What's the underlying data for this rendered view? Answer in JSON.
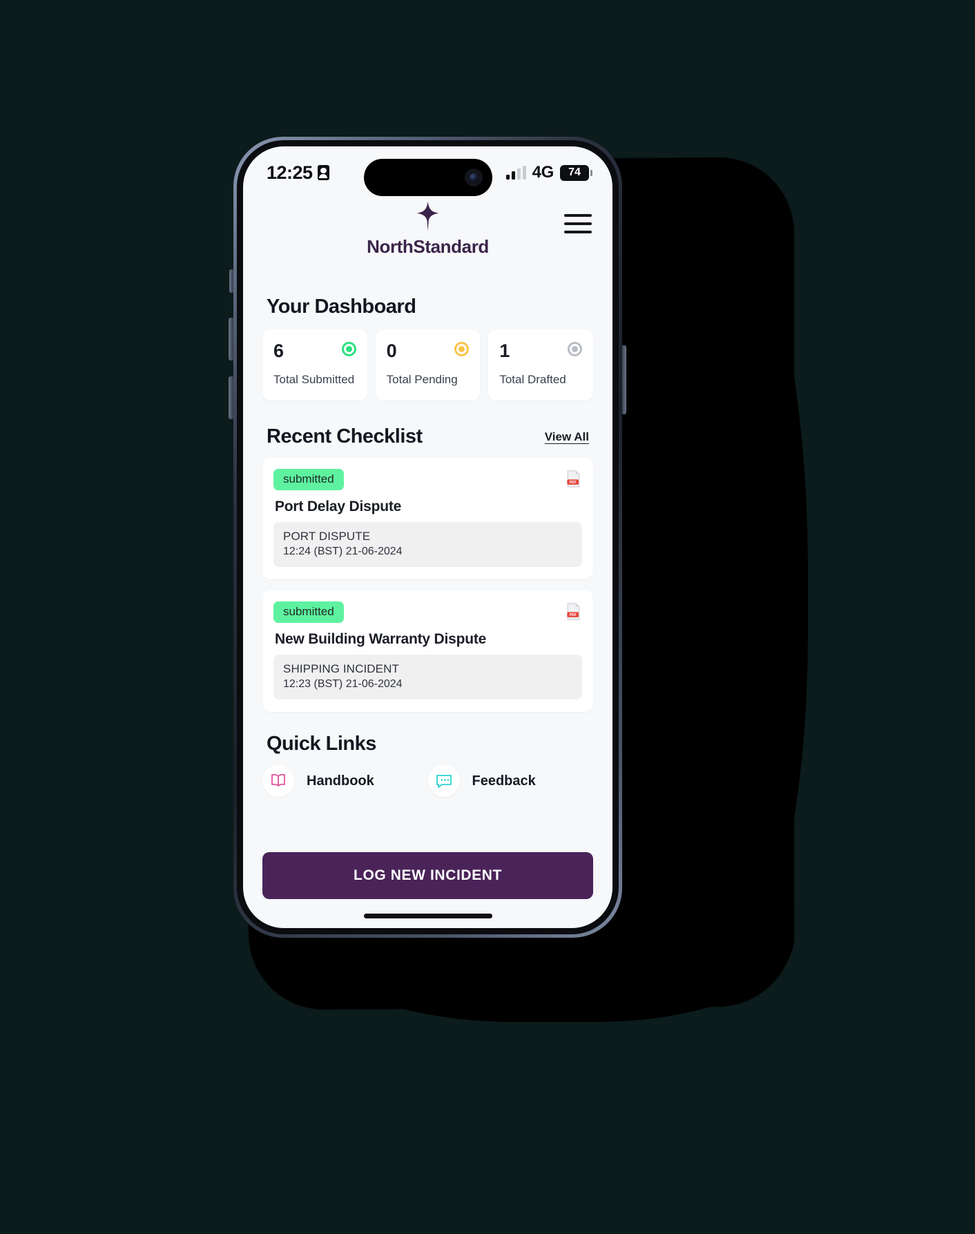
{
  "status_bar": {
    "time": "12:25",
    "lock_icon": "lock-portrait-icon",
    "network": "4G",
    "battery": "74",
    "signal_icon": "cellular-signal-icon"
  },
  "header": {
    "brand_name": "NorthStandard",
    "logo_icon": "northstandard-star-logo",
    "menu_icon": "hamburger-menu-icon",
    "brand_color": "#3b2449"
  },
  "dashboard": {
    "title": "Your Dashboard",
    "stats": [
      {
        "value": "6",
        "label": "Total Submitted",
        "dot_color": "#29e27f",
        "dot_icon": "status-dot-submitted"
      },
      {
        "value": "0",
        "label": "Total Pending",
        "dot_color": "#fbc34a",
        "dot_icon": "status-dot-pending"
      },
      {
        "value": "1",
        "label": "Total Drafted",
        "dot_color": "#b9bcc4",
        "dot_icon": "status-dot-drafted"
      }
    ]
  },
  "recent": {
    "title": "Recent Checklist",
    "view_all": "View All",
    "items": [
      {
        "status": "submitted",
        "title": "Port Delay Dispute",
        "type": "PORT DISPUTE",
        "timestamp": "12:24 (BST) 21-06-2024",
        "attachment_icon": "pdf-file-icon"
      },
      {
        "status": "submitted",
        "title": "New Building Warranty Dispute",
        "type": "SHIPPING INCIDENT",
        "timestamp": "12:23 (BST) 21-06-2024",
        "attachment_icon": "pdf-file-icon"
      }
    ]
  },
  "quick_links": {
    "title": "Quick Links",
    "items": [
      {
        "label": "Handbook",
        "icon": "open-book-icon",
        "color": "#e0519a"
      },
      {
        "label": "Feedback",
        "icon": "chat-bubble-icon",
        "color": "#2ad2d2"
      }
    ]
  },
  "cta": {
    "label": "LOG NEW INCIDENT",
    "color": "#4a2458"
  }
}
